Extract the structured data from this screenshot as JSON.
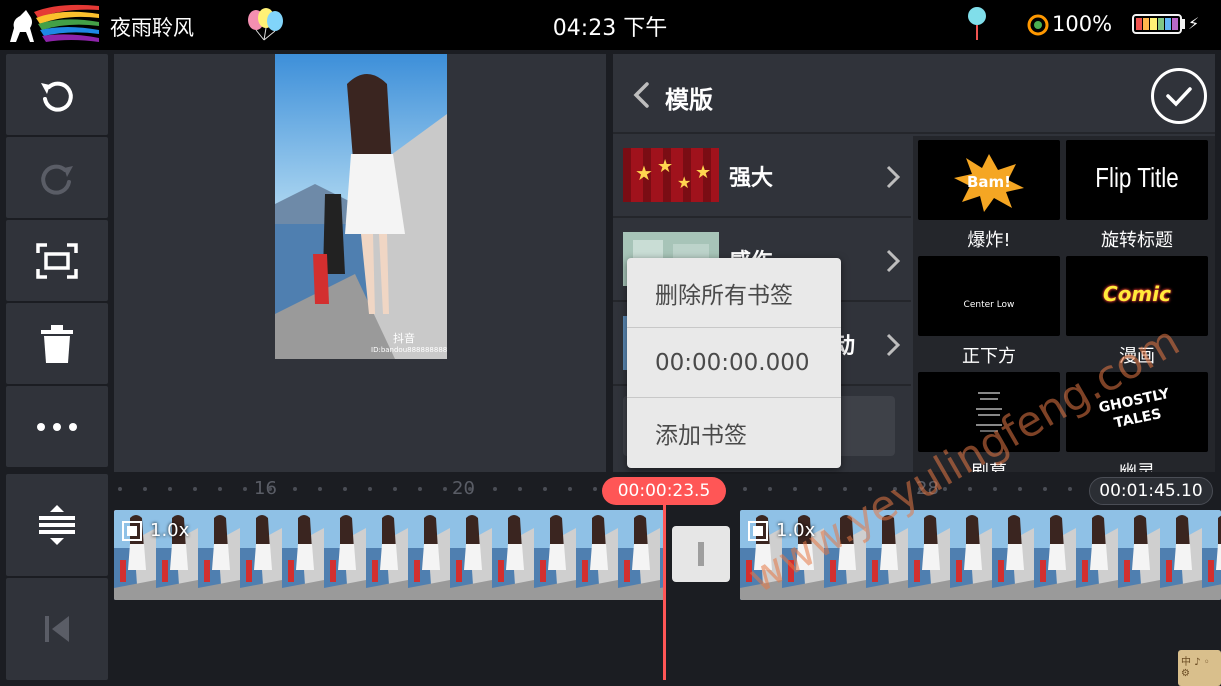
{
  "status_bar": {
    "app_name": "夜雨聆风",
    "time": "04:23 下午",
    "battery": "100%"
  },
  "toolbar": {
    "undo": "undo-icon",
    "redo": "redo-icon",
    "fullscreen": "fullscreen-icon",
    "delete": "trash-icon",
    "more": "more-icon",
    "expand": "expand-vertical-icon",
    "skip_start": "skip-to-start-icon"
  },
  "preview": {
    "watermark": "抖音",
    "id_text": "ID:bandou8888888888"
  },
  "panel": {
    "title": "模版",
    "categories": [
      {
        "label": "强大"
      },
      {
        "label": "感伤"
      },
      {
        "label": "动"
      }
    ],
    "templates": [
      {
        "label": "爆炸!",
        "thumb_text": "Bam!"
      },
      {
        "label": "旋转标题",
        "thumb_text": "Flip Title"
      },
      {
        "label": "正下方",
        "thumb_text": "Center Low"
      },
      {
        "label": "漫画",
        "thumb_text": "Comic"
      },
      {
        "label": "剧幕",
        "thumb_text": ""
      },
      {
        "label": "幽灵",
        "thumb_text": "GHOSTLY TALES"
      }
    ]
  },
  "popup": {
    "items": [
      {
        "label": "删除所有书签"
      },
      {
        "label": "00:00:00.000"
      },
      {
        "label": "添加书签"
      }
    ]
  },
  "timeline": {
    "ruler_labels": [
      "16",
      "20",
      "28"
    ],
    "playhead_time": "00:00:23.5",
    "total_time": "00:01:45.10",
    "clips": [
      {
        "speed": "1.0x",
        "selected": true
      },
      {
        "speed": "1.0x",
        "selected": false
      }
    ]
  },
  "watermark": "www.yeyulingfeng.com",
  "ime": "中 ♪ ◦ ⚙",
  "colors": {
    "accent": "#ff5656",
    "panel": "#30333a",
    "background": "#1b1d22",
    "popup": "#e9e9e9"
  }
}
